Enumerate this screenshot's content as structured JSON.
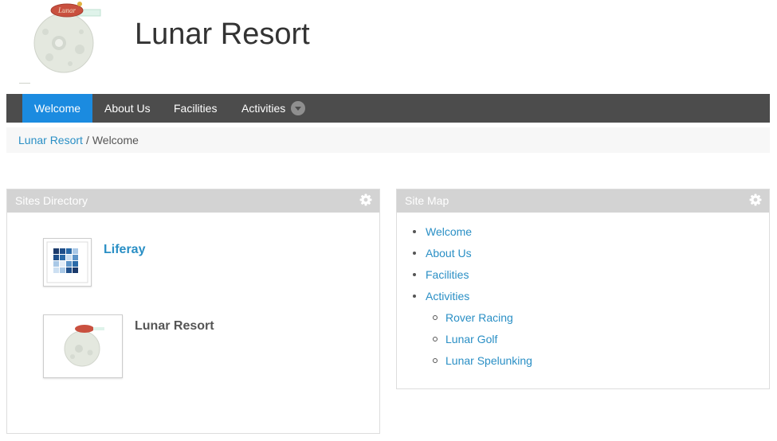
{
  "header": {
    "site_title": "Lunar Resort",
    "logo_sign_text": "Lunar"
  },
  "navigation": {
    "items": [
      {
        "label": "Welcome",
        "active": true
      },
      {
        "label": "About Us",
        "active": false
      },
      {
        "label": "Facilities",
        "active": false
      },
      {
        "label": "Activities",
        "active": false,
        "has_dropdown": true
      }
    ]
  },
  "breadcrumb": {
    "items": [
      "Lunar Resort",
      "Welcome"
    ],
    "separator": "/"
  },
  "sites_directory": {
    "title": "Sites Directory",
    "sites": [
      {
        "name": "Liferay",
        "linked": true
      },
      {
        "name": "Lunar Resort",
        "linked": false
      }
    ]
  },
  "site_map": {
    "title": "Site Map",
    "items": [
      "Welcome",
      "About Us",
      "Facilities",
      "Activities"
    ],
    "activities_children": [
      "Rover Racing",
      "Lunar Golf",
      "Lunar Spelunking"
    ]
  },
  "colors": {
    "nav_background": "#4c4c4c",
    "nav_active": "#1b8be0",
    "link": "#2a8fc5",
    "portlet_header": "#d3d3d3"
  },
  "icons": [
    "gear-icon",
    "chevron-down-icon",
    "moon-logo",
    "liferay-logo"
  ]
}
